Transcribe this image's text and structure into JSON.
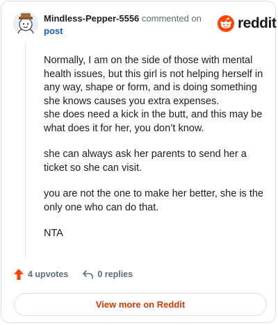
{
  "header": {
    "username": "Mindless-Pepper-5556",
    "action_text": "commented on",
    "post_link": "post",
    "brand_name": "reddit"
  },
  "comment": {
    "paragraphs": [
      "Normally, I am on the side of those with mental health issues, but this girl is not helping herself in any way, shape or form, and is doing something she knows causes you extra expenses.",
      "she does need a kick in the butt, and this may be what does it for her, you don’t know.",
      "she can always ask her parents to send her a ticket so she can visit.",
      "you are not the one to make her better, she is the only one who can do that.",
      "NTA"
    ]
  },
  "footer": {
    "upvotes": "4 upvotes",
    "replies": "0 replies",
    "view_more": "View more on Reddit"
  },
  "icons": {
    "avatar": "avatar-icon",
    "brand": "reddit-logo-icon",
    "upvote": "upvote-arrow-icon",
    "reply": "reply-arrow-icon"
  },
  "colors": {
    "brand_orange": "#ff4500",
    "upvote_orange": "#ff4500",
    "link_blue": "#1e57b8",
    "view_more_text": "#d93a00",
    "muted_text": "#576f76",
    "body_text": "#1c1c1c",
    "border": "#dcdfe2"
  }
}
